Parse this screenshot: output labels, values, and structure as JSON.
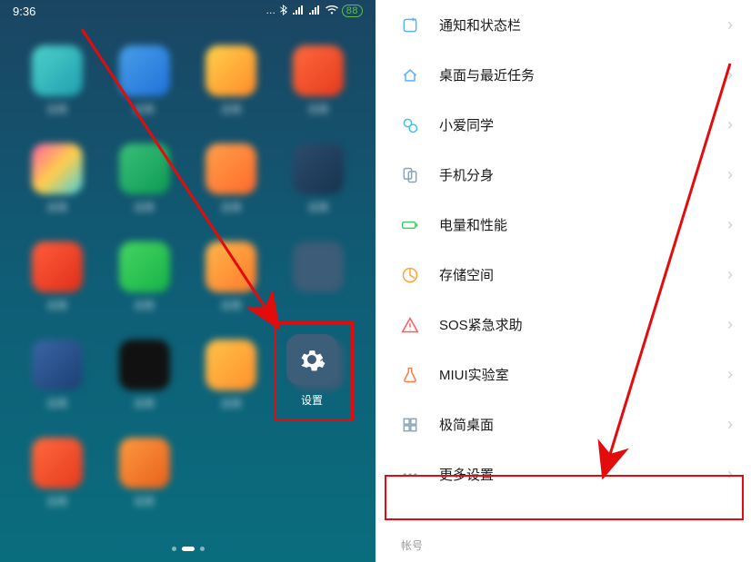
{
  "statusbar": {
    "time": "9:36",
    "battery": "88"
  },
  "home": {
    "settings_label": "设置",
    "blurred_apps": [
      {
        "colorClass": "c1",
        "label": "应用"
      },
      {
        "colorClass": "c2",
        "label": "应用"
      },
      {
        "colorClass": "c3",
        "label": "应用"
      },
      {
        "colorClass": "c4",
        "label": "应用"
      },
      {
        "colorClass": "c5",
        "label": "应用"
      },
      {
        "colorClass": "c6",
        "label": "应用"
      },
      {
        "colorClass": "c7",
        "label": "应用"
      },
      {
        "colorClass": "c8",
        "label": "应用"
      },
      {
        "colorClass": "c9",
        "label": "应用"
      },
      {
        "colorClass": "c10",
        "label": "应用"
      },
      {
        "colorClass": "c11",
        "label": "应用"
      },
      {
        "colorClass": "c12",
        "label": ""
      },
      {
        "colorClass": "c13",
        "label": "应用"
      },
      {
        "colorClass": "c14",
        "label": "应用"
      },
      {
        "colorClass": "c15",
        "label": "应用"
      },
      {
        "colorClass": "c12",
        "label": ""
      },
      {
        "colorClass": "c16",
        "label": "应用"
      },
      {
        "colorClass": "c17",
        "label": "应用"
      }
    ]
  },
  "settings": {
    "items": [
      {
        "id": "notification",
        "label": "通知和状态栏",
        "iconColor": "#5ab0ff"
      },
      {
        "id": "desktop",
        "label": "桌面与最近任务",
        "iconColor": "#5ab0ff"
      },
      {
        "id": "xiaoai",
        "label": "小爱同学",
        "iconColor": "#3cc4e6"
      },
      {
        "id": "phone-clone",
        "label": "手机分身",
        "iconColor": "#8aa4b5"
      },
      {
        "id": "battery",
        "label": "电量和性能",
        "iconColor": "#42c76a"
      },
      {
        "id": "storage",
        "label": "存储空间",
        "iconColor": "#ffa23c"
      },
      {
        "id": "sos",
        "label": "SOS紧急求助",
        "iconColor": "#ff5a5a"
      },
      {
        "id": "miui-lab",
        "label": "MIUI实验室",
        "iconColor": "#ff7a3c"
      },
      {
        "id": "simple-desktop",
        "label": "极简桌面",
        "iconColor": "#8aa4b5"
      },
      {
        "id": "more-settings",
        "label": "更多设置",
        "iconColor": "#8aa4b5"
      }
    ],
    "section_label": "帐号"
  },
  "annotations": {
    "highlight_settings_app": true,
    "highlight_more_settings": true,
    "arrow_color": "#e30b0b"
  }
}
